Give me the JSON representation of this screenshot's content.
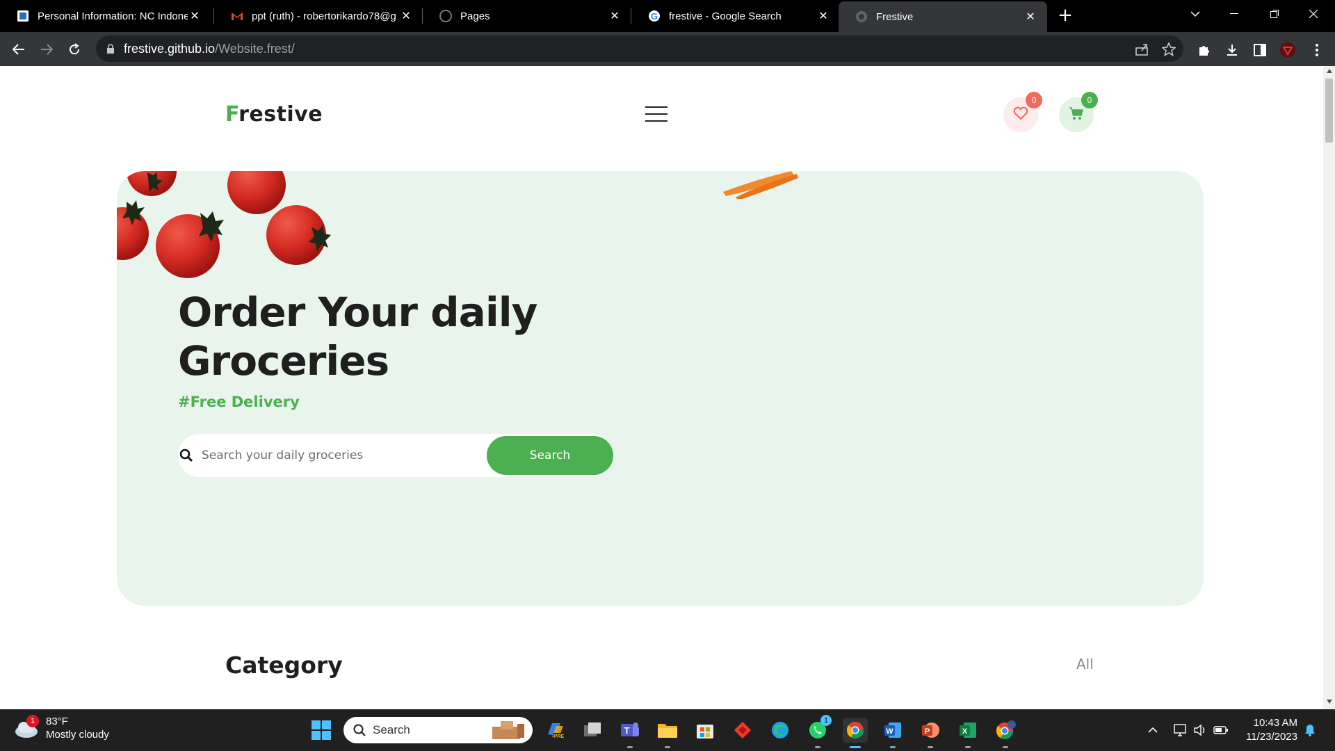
{
  "browser": {
    "tabs": [
      {
        "title": "Personal Information: NC Indone",
        "favicon": "org-favicon-icon",
        "active": false
      },
      {
        "title": "ppt (ruth) - robertorikardo78@g",
        "favicon": "gmail-icon",
        "active": false
      },
      {
        "title": "Pages",
        "favicon": "github-icon",
        "active": false
      },
      {
        "title": "frestive - Google Search",
        "favicon": "google-icon",
        "active": false
      },
      {
        "title": "Frestive",
        "favicon": "globe-icon",
        "active": true
      }
    ],
    "new_tab_label": "+",
    "url_host": "frestive.github.io",
    "url_path": "/Website.frest/"
  },
  "page": {
    "brand_first": "F",
    "brand_rest": "restive",
    "wishlist_count": "0",
    "cart_count": "0",
    "hero": {
      "title_line1": "Order Your daily",
      "title_line2": "Groceries",
      "subtitle": "#Free Delivery",
      "search_placeholder": "Search your daily groceries",
      "search_button": "Search"
    },
    "category": {
      "title": "Category",
      "all_link": "All"
    }
  },
  "taskbar": {
    "weather_temp": "83°F",
    "weather_desc": "Mostly cloudy",
    "weather_badge": "1",
    "search_label": "Search",
    "whatsapp_badge": "1",
    "time": "10:43 AM",
    "date": "11/23/2023"
  },
  "colors": {
    "accent_green": "#4caf50",
    "hero_bg": "#e9f5ec",
    "wishlist_red": "#f16a5c"
  }
}
